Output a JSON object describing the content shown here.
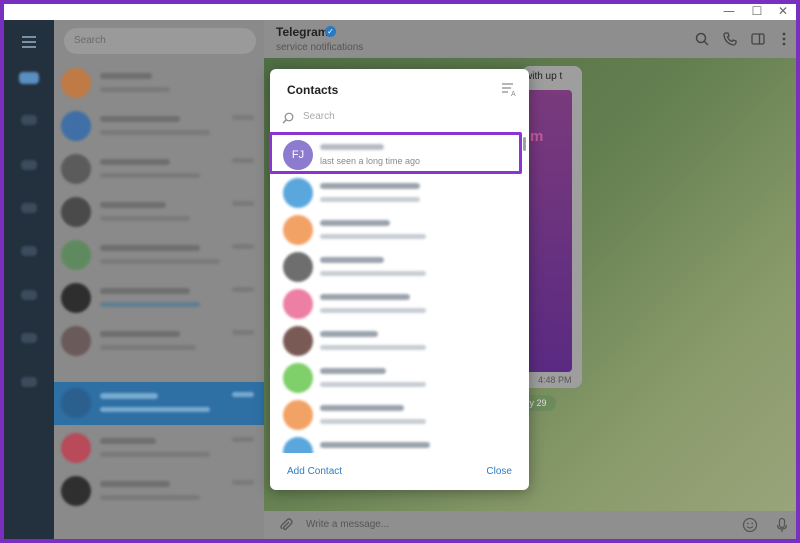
{
  "window": {
    "controls": {
      "minimize": "—",
      "maximize": "☐",
      "close": "✕"
    }
  },
  "sidebar": {
    "search_placeholder": "Search"
  },
  "chat_header": {
    "title": "Telegram",
    "subtitle": "service notifications"
  },
  "chat": {
    "bubble_text": "with up t",
    "bubble_image_text": "m",
    "bubble_time": "4:48 PM",
    "date_pill": "y 29",
    "bottom_text": "...",
    "composer_placeholder": "Write a message..."
  },
  "contacts_dialog": {
    "title": "Contacts",
    "search_placeholder": "Search",
    "first_contact": {
      "initials": "FJ",
      "status": "last seen a long time ago",
      "avatar_color": "#8c7bcf"
    },
    "add_label": "Add Contact",
    "close_label": "Close"
  },
  "colors": {
    "highlight": "#8a35d1",
    "link": "#2d7cc1",
    "selected_chat": "#2e6fa4"
  }
}
